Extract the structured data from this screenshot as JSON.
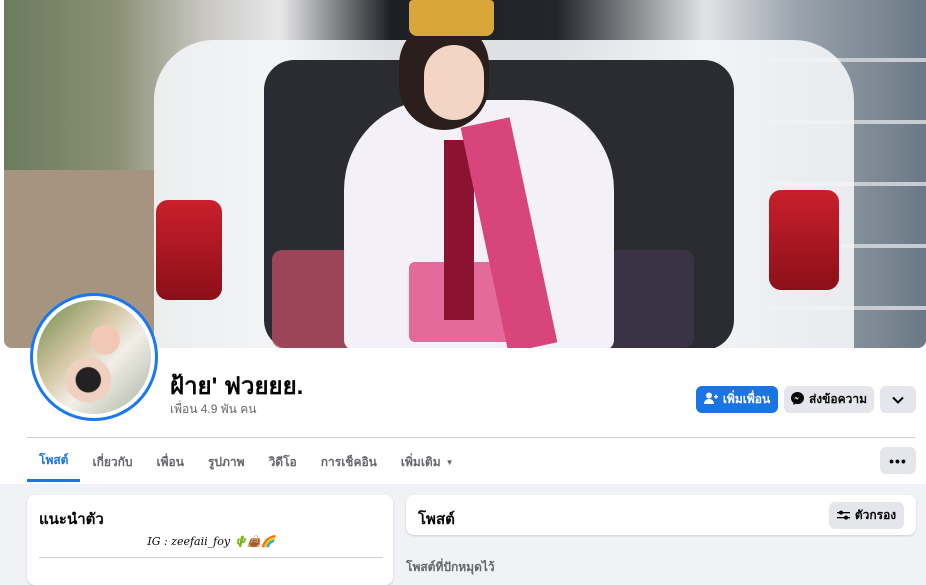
{
  "profile": {
    "name": "ฝ้าย' ฟวยยย.",
    "friends": "เพื่อน 4.9 พัน คน"
  },
  "actions": {
    "add_friend": "เพิ่มเพื่อน",
    "message": "ส่งข้อความ",
    "more": "⌄",
    "dots": "•••"
  },
  "tabs": [
    {
      "label": "โพสต์",
      "active": true
    },
    {
      "label": "เกี่ยวกับ"
    },
    {
      "label": "เพื่อน"
    },
    {
      "label": "รูปภาพ"
    },
    {
      "label": "วิดีโอ"
    },
    {
      "label": "การเช็คอิน"
    },
    {
      "label": "เพิ่มเติม"
    }
  ],
  "intro": {
    "title": "แนะนำตัว",
    "bio": "IG : zeefaii_foy 🌵👜🌈"
  },
  "posts": {
    "title": "โพสต์",
    "filter": "ตัวกรอง",
    "pinned": "โพสต์ที่ปักหมุดไว้"
  },
  "colors": {
    "accent": "#1b74e4",
    "secondary_button": "#e4e6eb",
    "background": "#f0f2f5"
  },
  "icons": [
    "add-friend-icon",
    "messenger-icon",
    "chevron-down-icon",
    "more-dots-icon",
    "filter-icon",
    "caret-down-icon"
  ]
}
